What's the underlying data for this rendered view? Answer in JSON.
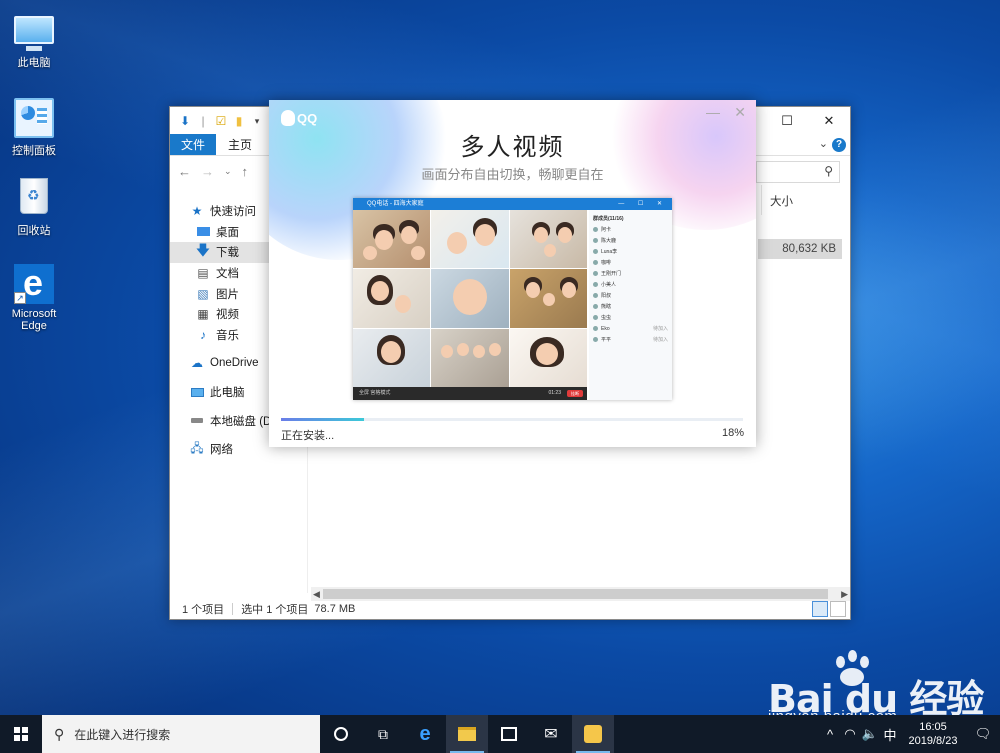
{
  "desktop": {
    "icons": [
      {
        "label": "此电脑",
        "icon": "computer-icon"
      },
      {
        "label": "控制面板",
        "icon": "control-panel-icon"
      },
      {
        "label": "回收站",
        "icon": "recycle-bin-icon"
      },
      {
        "label": "Microsoft Edge",
        "icon": "edge-icon"
      }
    ]
  },
  "explorer": {
    "tabs": [
      "文件",
      "主页"
    ],
    "nav": [
      {
        "label": "快速访问",
        "icon": "star-icon"
      },
      {
        "label": "桌面",
        "icon": "desktop-folder-icon"
      },
      {
        "label": "下载",
        "icon": "download-arrow-icon"
      },
      {
        "label": "文档",
        "icon": "documents-icon"
      },
      {
        "label": "图片",
        "icon": "pictures-icon"
      },
      {
        "label": "视频",
        "icon": "videos-icon"
      },
      {
        "label": "音乐",
        "icon": "music-icon"
      },
      {
        "label": "OneDrive",
        "icon": "cloud-icon"
      },
      {
        "label": "此电脑",
        "icon": "computer-icon"
      },
      {
        "label": "本地磁盘 (D:)",
        "icon": "drive-icon"
      },
      {
        "label": "网络",
        "icon": "network-icon"
      }
    ],
    "column_size": "大小",
    "file_size": "80,632 KB",
    "status": {
      "items_count": "1 个项目",
      "selected": "选中 1 个项目",
      "size": "78.7 MB"
    }
  },
  "qq": {
    "brand": "QQ",
    "title": "多人视频",
    "subtitle": "画面分布自由切换，畅聊更自在",
    "preview": {
      "window_title": "QQ电话 - 四海大家庭",
      "member_header": "群成员(11/16)",
      "members": [
        "阿卡",
        "陈大鹿",
        "Luna李",
        "咖啡",
        "王刚开门",
        "小美人",
        "阳叔",
        "熊瞎",
        "虫虫",
        "Eko",
        "平平"
      ],
      "member_tags": [
        "",
        "",
        "",
        "",
        "",
        "",
        "",
        "",
        "",
        "待加入",
        "待加入"
      ],
      "bar_text": "全屏   宫格模式",
      "timer": "01:23",
      "end_label": "挂断"
    },
    "progress": 0.18,
    "status_text": "正在安装...",
    "percent_text": "18%"
  },
  "watermark": {
    "logo": "Bai  du 经验",
    "url": "jingyan.baidu.com"
  },
  "taskbar": {
    "search_placeholder": "在此键入进行搜索",
    "ime": "中",
    "time": "16:05",
    "date": "2019/8/23"
  }
}
